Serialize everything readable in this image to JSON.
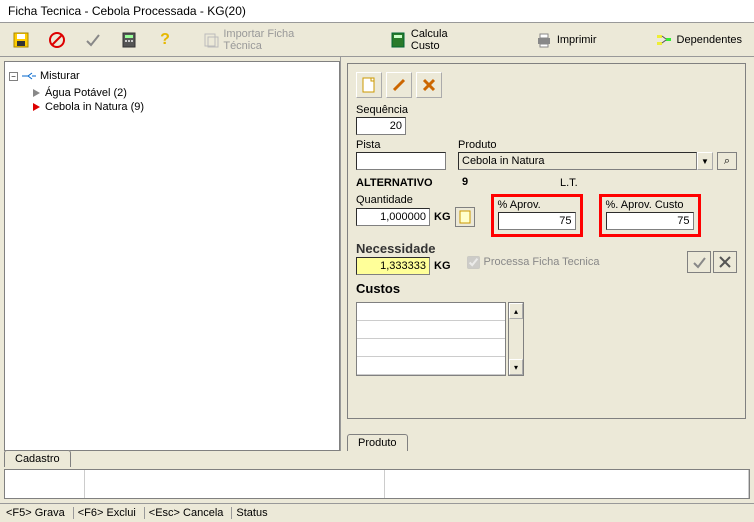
{
  "title": "Ficha Tecnica - Cebola Processada - KG(20)",
  "toolbar": {
    "save_icon": "save",
    "cancel_icon": "cancel",
    "check_icon": "check",
    "calc_icon": "calculator",
    "help_icon": "help",
    "import_label": "Importar Ficha Técnica",
    "calcula_label": "Calcula Custo",
    "imprimir_label": "Imprimir",
    "dependentes_label": "Dependentes"
  },
  "tree": {
    "root": "Misturar",
    "children": [
      {
        "label": "Água Potável (2)"
      },
      {
        "label": "Cebola in Natura (9)"
      }
    ]
  },
  "detail": {
    "sequencia_label": "Sequência",
    "sequencia_value": "20",
    "pista_label": "Pista",
    "pista_value": "",
    "produto_label": "Produto",
    "produto_value": "Cebola in Natura",
    "alternativo_label": "ALTERNATIVO",
    "alternativo_value": "9",
    "lt_label": "L.T.",
    "quantidade_label": "Quantidade",
    "quantidade_value": "1,000000",
    "quantidade_unit": "KG",
    "aprov_label": "% Aprov.",
    "aprov_value": "75",
    "aprov_custo_label": "%. Aprov. Custo",
    "aprov_custo_value": "75",
    "necessidade_label": "Necessidade",
    "necessidade_value": "1,333333",
    "necessidade_unit": "KG",
    "processa_label": "Processa Ficha Tecnica",
    "custos_label": "Custos"
  },
  "tabs": {
    "produto": "Produto",
    "cadastro": "Cadastro"
  },
  "footer": {
    "f5": "<F5> Grava",
    "f6": "<F6> Exclui",
    "esc": "<Esc> Cancela",
    "status": "Status"
  }
}
